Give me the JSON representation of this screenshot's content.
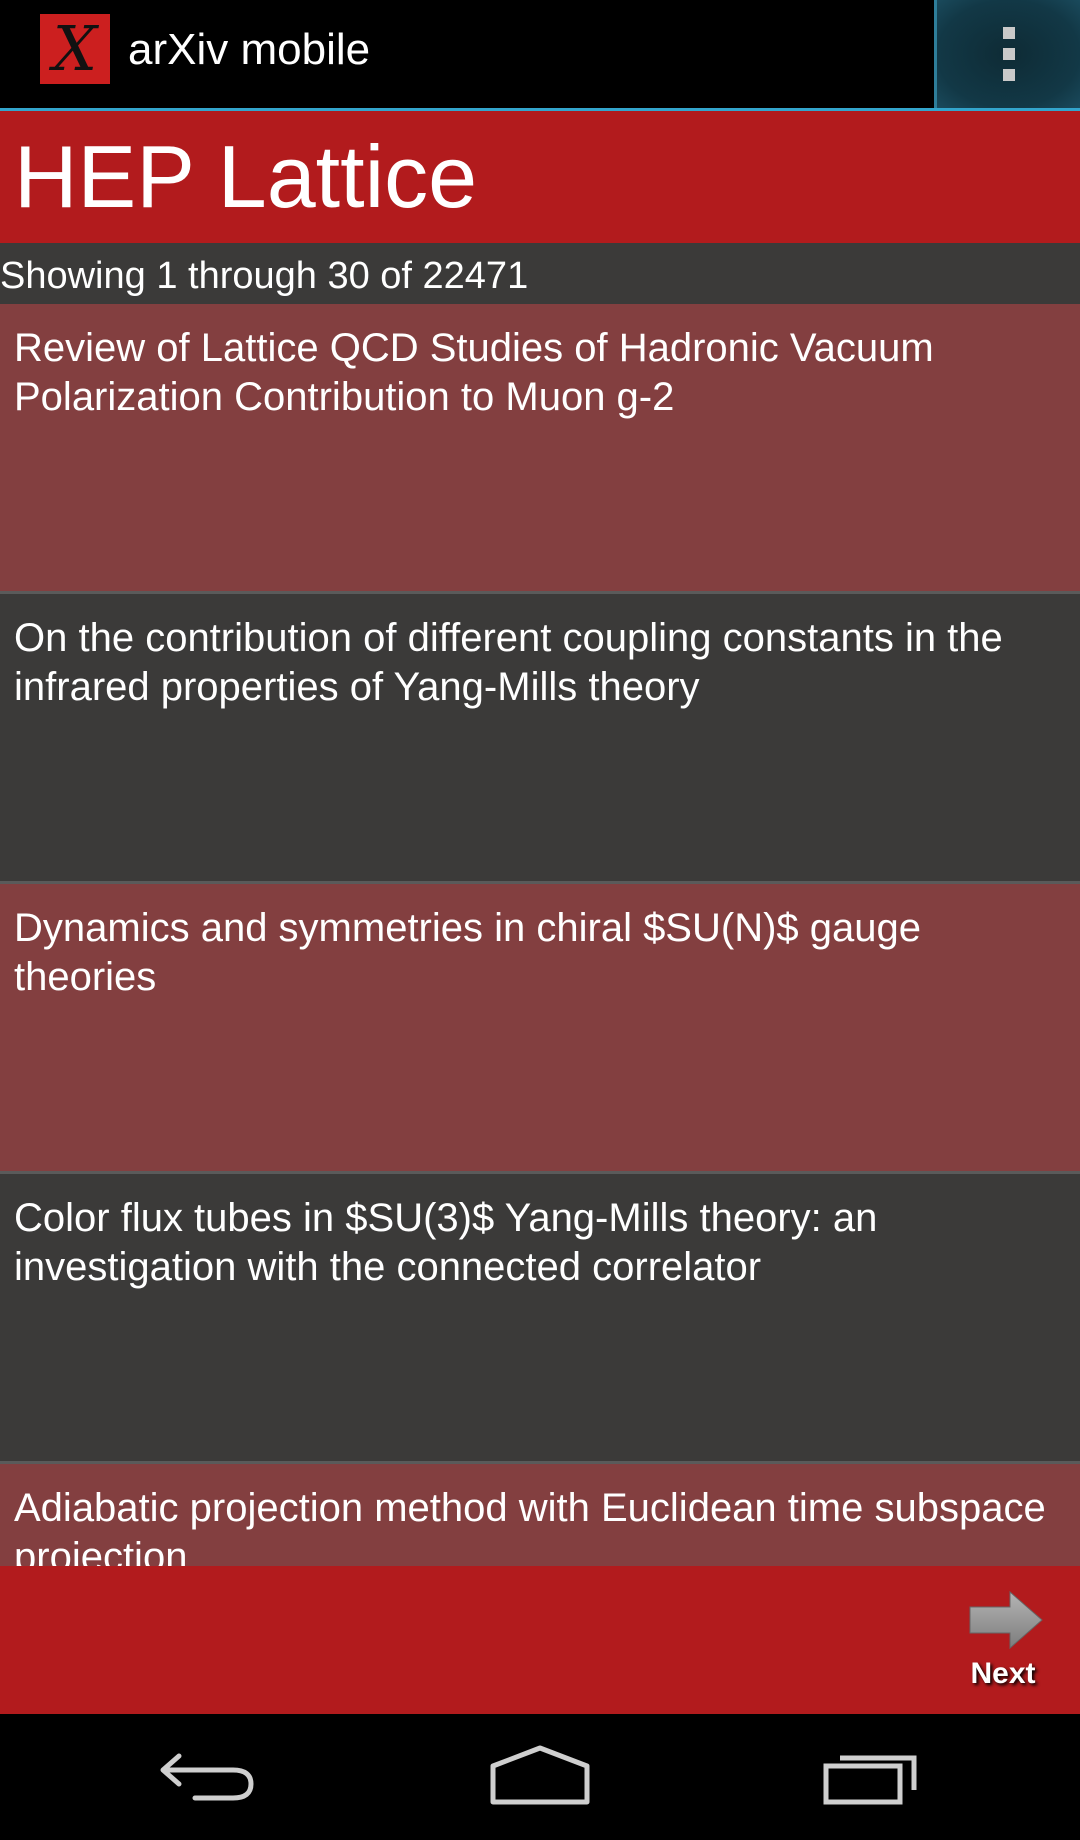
{
  "action_bar": {
    "logo_glyph": "X",
    "title": "arXiv mobile",
    "overflow_icon": "overflow-menu-icon"
  },
  "category": {
    "title": "HEP Lattice"
  },
  "listing": {
    "status": "Showing 1 through 30 of 22471",
    "items": [
      {
        "title": "Review of Lattice QCD Studies of Hadronic Vacuum Polarization Contribution to Muon g-2"
      },
      {
        "title": "On the contribution of different coupling constants in the infrared properties of Yang-Mills theory"
      },
      {
        "title": "Dynamics and symmetries in chiral $SU(N)$ gauge theories"
      },
      {
        "title": "Color flux tubes in $SU(3)$ Yang-Mills theory: an investigation with the connected correlator"
      },
      {
        "title": "Adiabatic projection method with Euclidean time subspace projection"
      }
    ]
  },
  "bottom_bar": {
    "next_label": "Next",
    "next_icon": "arrow-right-icon"
  },
  "nav_bar": {
    "back_icon": "back-icon",
    "home_icon": "home-icon",
    "recents_icon": "recent-apps-icon"
  },
  "colors": {
    "brand_red": "#b21b1d",
    "row_odd": "#833f40",
    "row_even": "#3b3a39",
    "accent_blue": "#33a5cc"
  }
}
